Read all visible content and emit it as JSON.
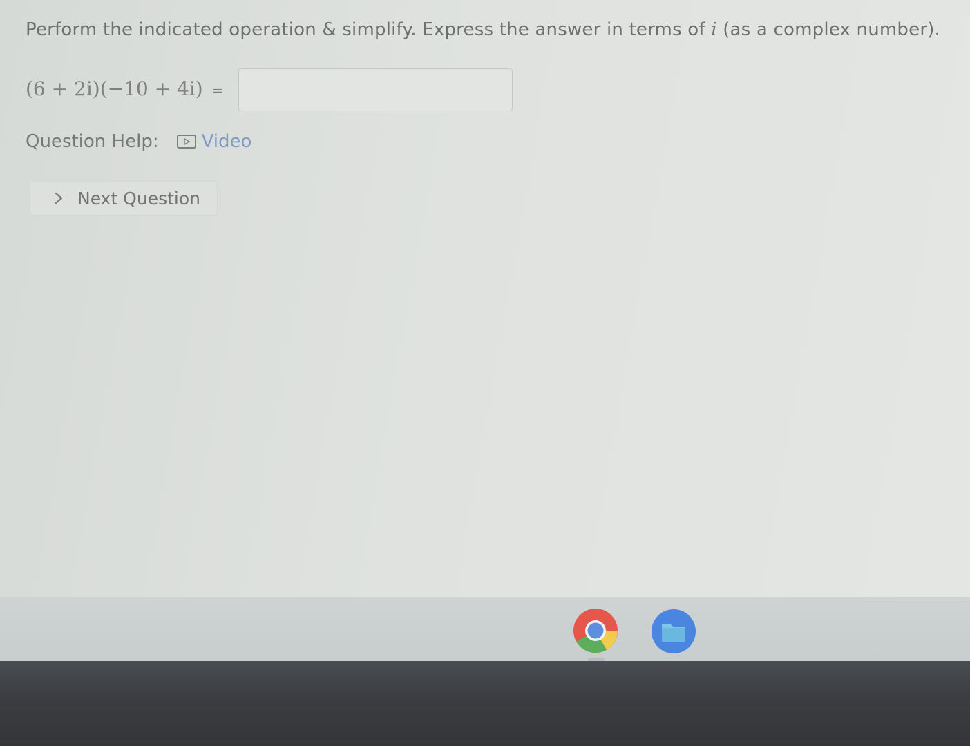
{
  "question": {
    "prompt_before_var": "Perform the indicated operation & simplify. Express the answer in terms of ",
    "prompt_var": "i",
    "prompt_after_var": " (as a complex number).",
    "expression": "(6 + 2i)(−10 + 4i)",
    "equals": "=",
    "answer_value": ""
  },
  "help": {
    "label": "Question Help:",
    "video_icon": "video-play-icon",
    "video_label": "Video"
  },
  "next_button": {
    "icon": "chevron-right-icon",
    "label": "Next Question"
  },
  "shelf": {
    "apps": [
      {
        "name": "Chrome",
        "icon": "chrome-icon",
        "active": true
      },
      {
        "name": "Files",
        "icon": "files-icon",
        "active": false
      }
    ]
  },
  "colors": {
    "link": "#7f9ac8",
    "text": "#6d706e",
    "background": "#dcdfdc",
    "bezel": "#3c3e42"
  }
}
